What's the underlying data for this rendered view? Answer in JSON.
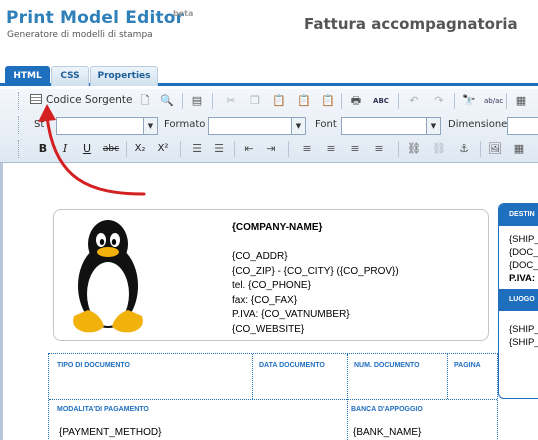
{
  "app": {
    "title": "Print Model Editor",
    "beta": "beta",
    "subtitle": "Generatore di modelli di stampa",
    "document_title": "Fattura accompagnatoria"
  },
  "tabs": [
    {
      "label": "HTML",
      "active": true
    },
    {
      "label": "CSS",
      "active": false
    },
    {
      "label": "Properties",
      "active": false
    }
  ],
  "toolbar": {
    "source_label": "Codice Sorgente",
    "style_label": "St",
    "format_label": "Formato",
    "font_label": "Font",
    "size_label": "Dimensione",
    "style_value": "",
    "format_value": "",
    "font_value": "",
    "bold": "B",
    "italic": "I",
    "underline": "U",
    "strike": "abc",
    "subscript": "X₂",
    "superscript": "X²",
    "spell": "ABC",
    "find_replace": "ab/ac"
  },
  "company": {
    "name": "{COMPANY-NAME}",
    "addr": "{CO_ADDR}",
    "zip_city": "{CO_ZIP} - {CO_CITY} ({CO_PROV})",
    "phone": "tel. {CO_PHONE}",
    "fax": "fax: {CO_FAX}",
    "vat": "P.IVA: {CO_VATNUMBER}",
    "website": "{CO_WEBSITE}"
  },
  "shipping": {
    "head1": "DESTIN",
    "ship1": "{SHIP_",
    "doc1": "{DOC_",
    "doc2": "{DOC_",
    "piva": "P.IVA:",
    "head2": "LUOGO",
    "ship2": "{SHIP_",
    "ship3": "{SHIP_"
  },
  "doc_table": {
    "col_tipo": "TIPO DI DOCUMENTO",
    "col_data": "DATA DOCUMENTO",
    "col_num": "NUM. DOCUMENTO",
    "col_pagina": "PAGINA",
    "col_pagamento": "MODALITA'DI PAGAMENTO",
    "col_banca": "BANCA D'APPOGGIO",
    "payment_method": "{PAYMENT_METHOD}",
    "bank_name": "{BANK_NAME}"
  },
  "colors": {
    "accent": "#1f6fbf",
    "logo": "#2f7fb8",
    "arrow": "#d42020"
  },
  "icons": [
    "source-icon",
    "new-page-icon",
    "preview-icon",
    "templates-icon",
    "cut-icon",
    "copy-icon",
    "paste-icon",
    "paste-text-icon",
    "paste-word-icon",
    "print-icon",
    "spellcheck-icon",
    "undo-icon",
    "redo-icon",
    "find-icon",
    "replace-icon",
    "select-all-icon",
    "tux-penguin-icon"
  ]
}
